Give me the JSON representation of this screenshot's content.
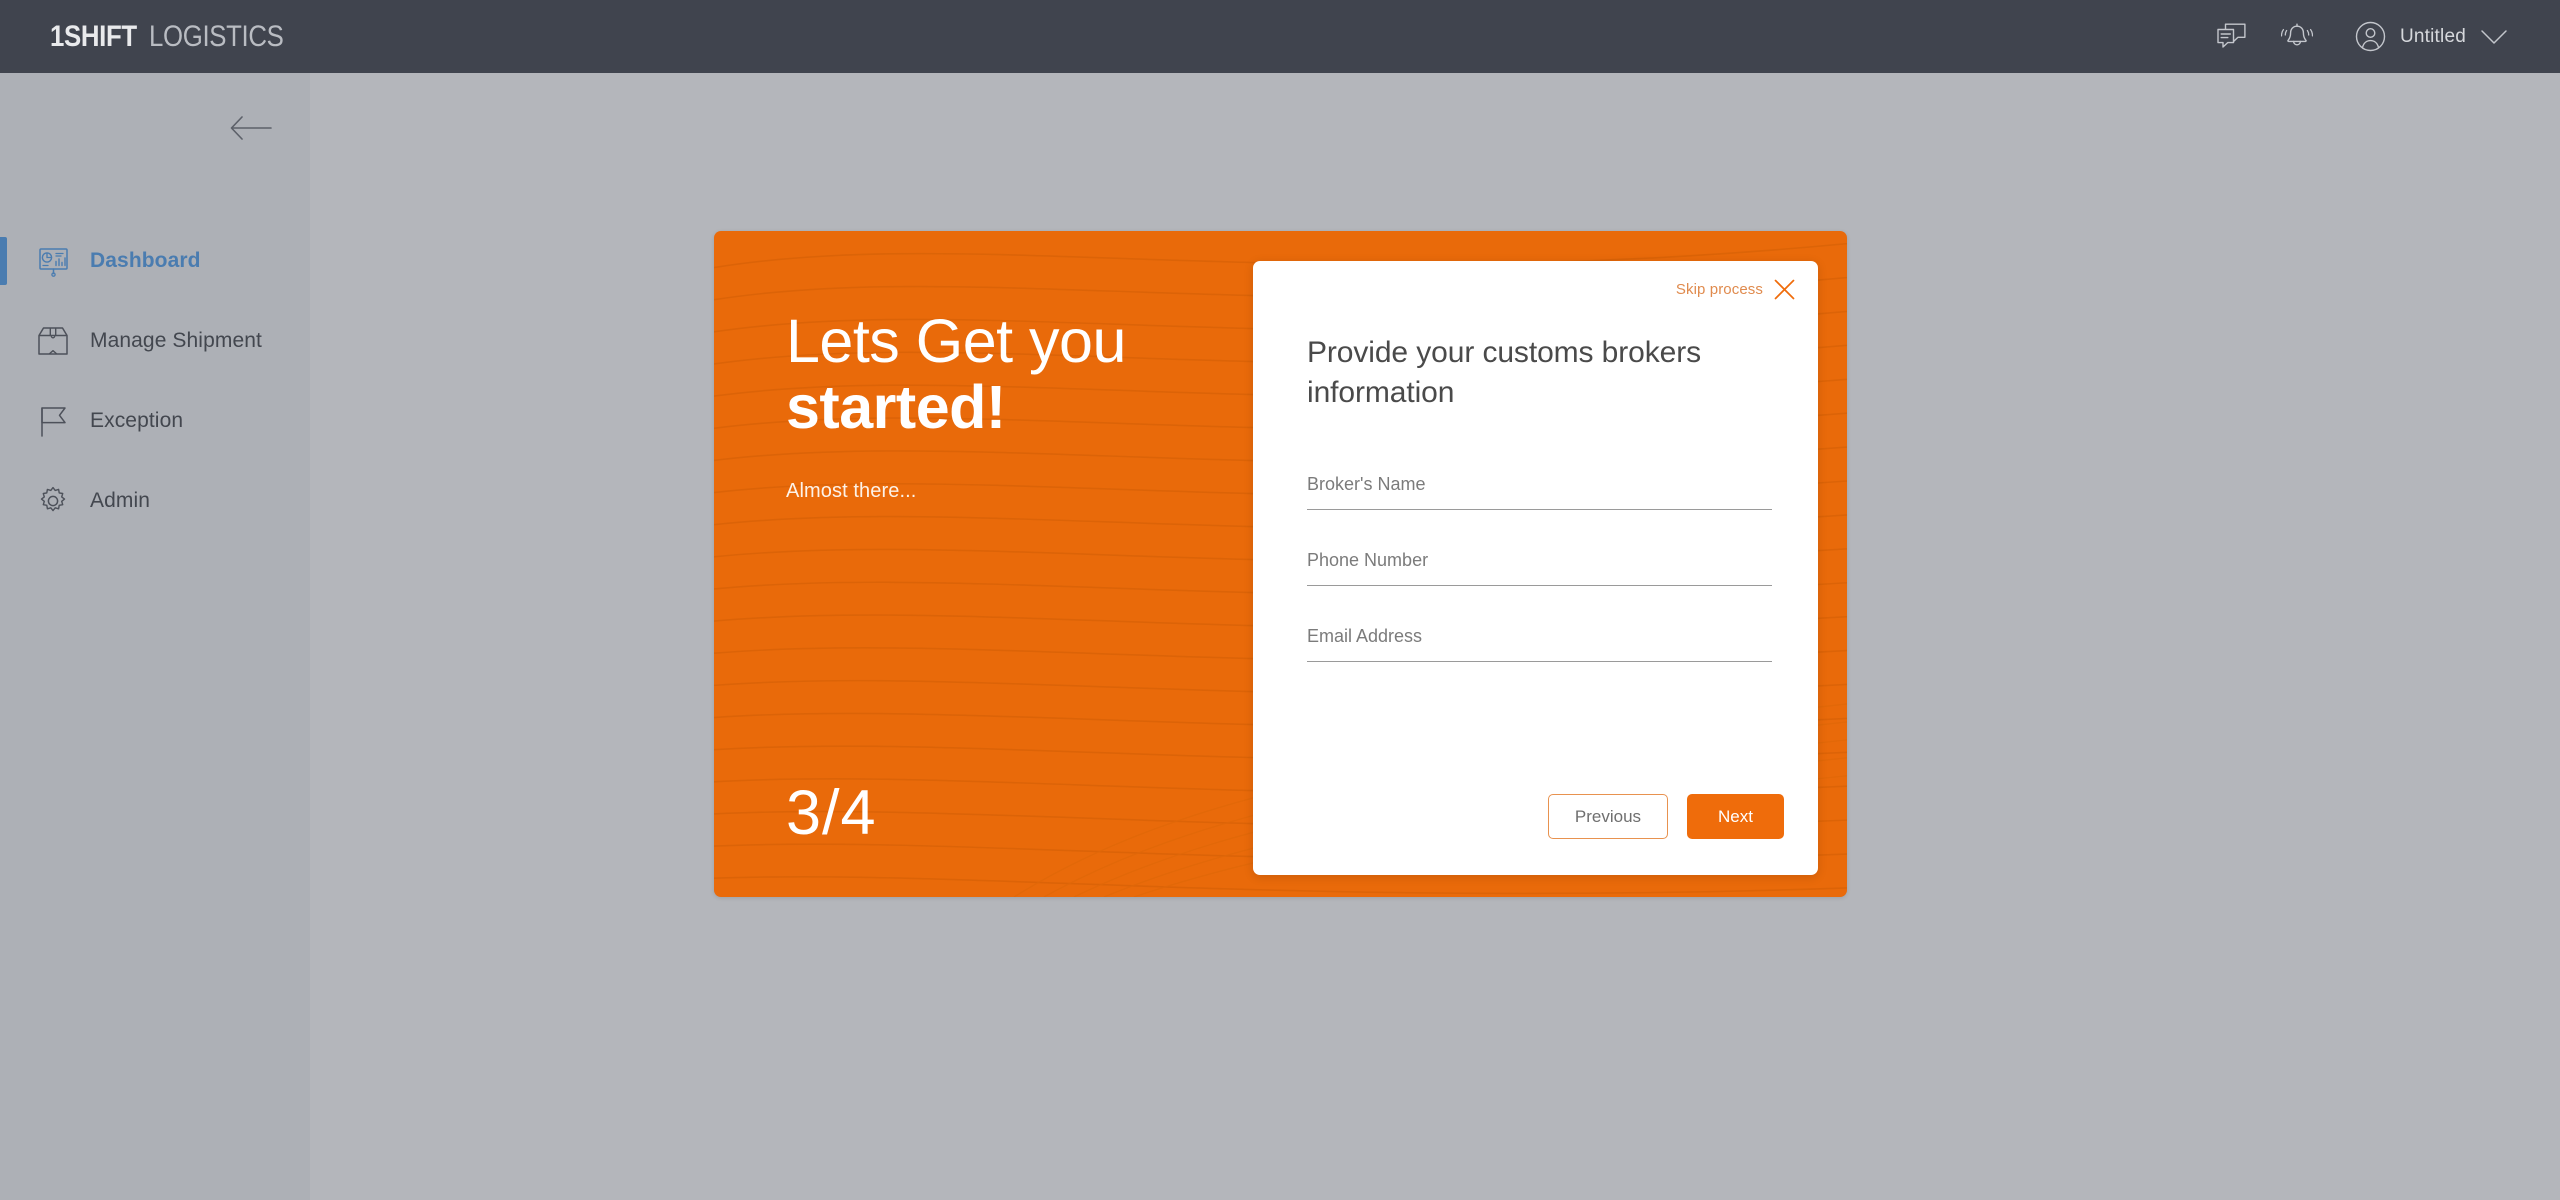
{
  "topbar": {
    "brand_primary": "1SHIFT",
    "brand_secondary": "LOGISTICS",
    "messages_icon": "chat-bubbles-icon",
    "notifications_icon": "bell-icon",
    "avatar_icon": "user-avatar-icon",
    "user_name": "Untitled",
    "dropdown_icon": "chevron-down-icon",
    "background_color": "#40444E"
  },
  "sidebar": {
    "collapse_icon": "arrow-left-icon",
    "background_color": "#ADB0B6",
    "active_color": "#4A7CB0",
    "items": [
      {
        "label": "Dashboard",
        "icon": "dashboard-presentation-icon",
        "active": true
      },
      {
        "label": "Manage Shipment",
        "icon": "package-box-icon",
        "active": false
      },
      {
        "label": "Exception",
        "icon": "flag-icon",
        "active": false
      },
      {
        "label": "Admin",
        "icon": "gear-icon",
        "active": false
      }
    ]
  },
  "onboarding": {
    "accent_color": "#E96A0A",
    "hero_line_1": "Lets Get you",
    "hero_line_2": "started!",
    "subtitle": "Almost there...",
    "step_counter": "3/4",
    "current_step": 3,
    "total_steps": 4
  },
  "modal": {
    "skip_label": "Skip process",
    "close_icon": "close-x-icon",
    "title": "Provide your customs brokers information",
    "fields": [
      {
        "name": "brokers-name",
        "placeholder": "Broker's Name",
        "value": ""
      },
      {
        "name": "phone-number",
        "placeholder": "Phone Number",
        "value": ""
      },
      {
        "name": "email-address",
        "placeholder": "Email Address",
        "value": ""
      }
    ],
    "previous_label": "Previous",
    "next_label": "Next"
  }
}
